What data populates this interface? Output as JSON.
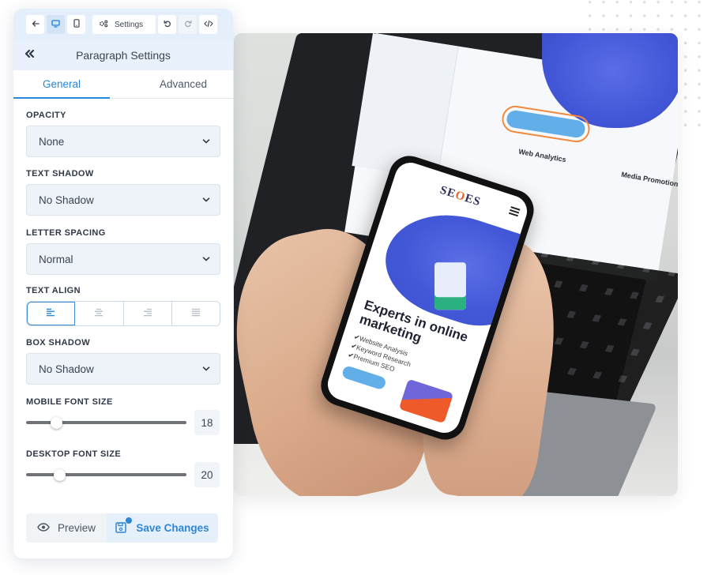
{
  "toolbar": {
    "back_icon": "arrow-left-icon",
    "desktop_icon": "desktop-icon",
    "mobile_icon": "mobile-icon",
    "settings_icon": "gears-icon",
    "settings_label": "Settings",
    "undo_icon": "undo-icon",
    "redo_icon": "redo-icon",
    "code_icon": "code-icon",
    "active_view": "desktop"
  },
  "panel": {
    "collapse_icon": "double-chevron-left-icon",
    "title": "Paragraph Settings",
    "tabs": [
      {
        "label": "General",
        "active": true
      },
      {
        "label": "Advanced",
        "active": false
      }
    ]
  },
  "fields": {
    "opacity": {
      "label": "Opacity",
      "value": "None"
    },
    "text_shadow": {
      "label": "Text Shadow",
      "value": "No Shadow"
    },
    "letter_spacing": {
      "label": "Letter Spacing",
      "value": "Normal"
    },
    "text_align": {
      "label": "Text Align",
      "options": [
        "left",
        "center",
        "right",
        "justify"
      ],
      "selected": "left"
    },
    "box_shadow": {
      "label": "Box Shadow",
      "value": "No Shadow"
    },
    "mobile_font_size": {
      "label": "Mobile Font Size",
      "value": "18",
      "slider_fraction": 0.19
    },
    "desktop_font_size": {
      "label": "Desktop Font Size",
      "value": "20",
      "slider_fraction": 0.21
    }
  },
  "footer": {
    "preview_label": "Preview",
    "save_label": "Save Changes",
    "has_unsaved_indicator": true
  },
  "colors": {
    "accent": "#2787d8",
    "toolbar_bg": "#e4effb",
    "title_bg": "#e9f2fc",
    "select_bg": "#eef3f9"
  },
  "photo": {
    "phone_logo": "SEOES",
    "phone_headline": "Experts in online marketing",
    "phone_bullets": [
      "Website Analysis",
      "Keyword Research",
      "Premium SEO"
    ],
    "laptop_features": [
      "Web Analytics",
      "Media Promotion"
    ]
  }
}
